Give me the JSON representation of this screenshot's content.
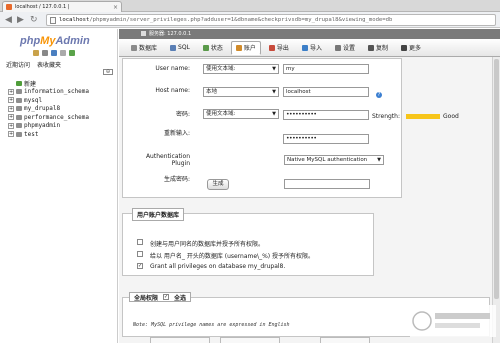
{
  "browser": {
    "tab_title": "localhost / 127.0.0.1 |",
    "tab_close": "×",
    "url_host": "localhost",
    "url_path": "/phpmyadmin/server_privileges.php?adduser=1&dbname&checkprivsdb=my_drupal8&viewing_mode=db"
  },
  "sidebar": {
    "logo_php": "php",
    "logo_my": "My",
    "logo_admin": "Admin",
    "tabs": [
      "近期访问",
      "表收藏夹"
    ],
    "collapse": "⊖",
    "new_label": "新建",
    "databases": [
      "information_schema",
      "mysql",
      "my_drupal8",
      "performance_schema",
      "phpmyadmin",
      "test"
    ]
  },
  "breadcrumb": "服务器: 127.0.0.1",
  "menu": [
    {
      "label": "数据库",
      "icon": "database-icon",
      "color": "#8a8a8a"
    },
    {
      "label": "SQL",
      "icon": "sql-icon",
      "color": "#5a7fb5"
    },
    {
      "label": "状态",
      "icon": "status-icon",
      "color": "#5a9a4a"
    },
    {
      "label": "账户",
      "icon": "users-icon",
      "color": "#d18b2a",
      "active": true
    },
    {
      "label": "导出",
      "icon": "export-icon",
      "color": "#c84b3c"
    },
    {
      "label": "导入",
      "icon": "import-icon",
      "color": "#3c7fc8"
    },
    {
      "label": "设置",
      "icon": "gear-icon",
      "color": "#777"
    },
    {
      "label": "复制",
      "icon": "replication-icon",
      "color": "#555"
    },
    {
      "label": "更多",
      "icon": "chevron-down-icon",
      "color": "#444"
    }
  ],
  "form": {
    "user_name_label": "User name:",
    "user_name_type": "使用文本域:",
    "user_name_value": "my",
    "host_name_label": "Host name:",
    "host_name_type": "本地",
    "host_name_value": "localhost",
    "password_label": "密码:",
    "password_type": "使用文本域:",
    "password_value": "••••••••••",
    "reenter_label": "重新输入:",
    "reenter_value": "••••••••••",
    "strength_label": "Strength:",
    "strength_value": "Good",
    "auth_label_1": "Authentication",
    "auth_label_2": "Plugin",
    "auth_value": "Native MySQL authentication",
    "generate_label": "生成密码:",
    "generate_button": "生成"
  },
  "db_section": {
    "legend": "用户账户数据库",
    "options": [
      {
        "label": "创建与用户同名的数据库并授予所有权限。",
        "checked": false
      },
      {
        "label": "给以 用户名_ 开头的数据库 (username\\_%) 授予所有权限。",
        "checked": false
      },
      {
        "label": "Grant all privileges on database my_drupal8.",
        "checked": true
      }
    ]
  },
  "global_section": {
    "legend": "全局权限",
    "check_all": "全选",
    "note": "Note: MySQL privilege names are expressed in English"
  }
}
